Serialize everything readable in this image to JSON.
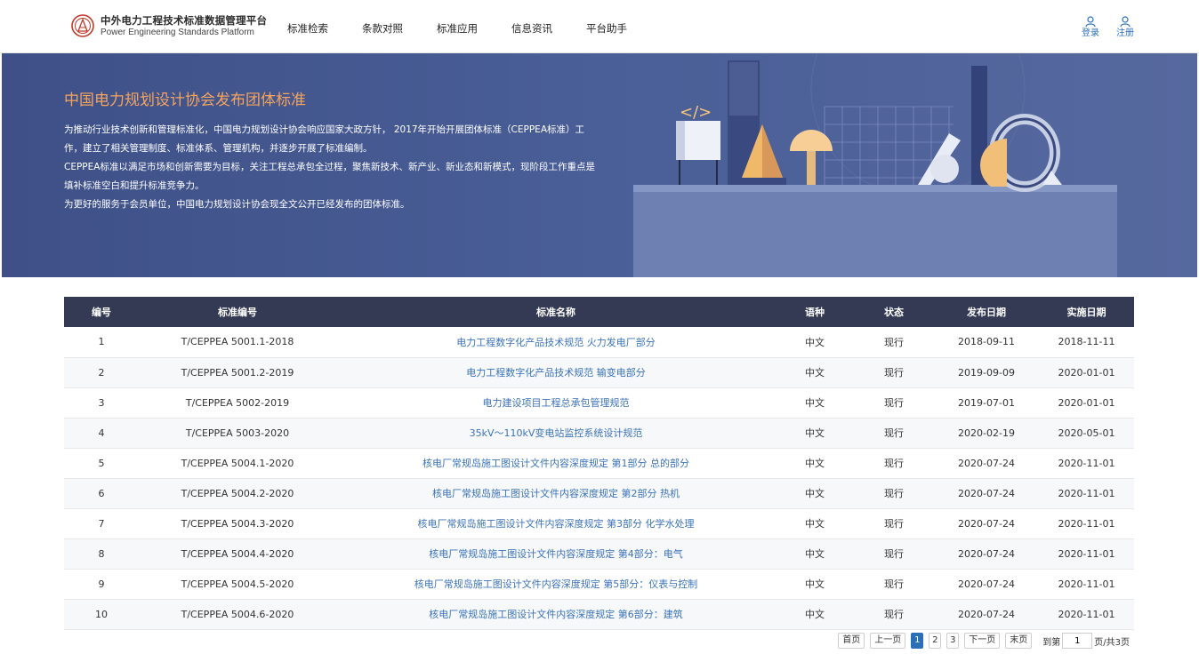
{
  "header": {
    "brand_cn": "中外电力工程技术标准数据管理平台",
    "brand_en": "Power Engineering Standards Platform",
    "nav": [
      "标准检索",
      "条款对照",
      "标准应用",
      "信息资讯",
      "平台助手"
    ],
    "login_label": "登录",
    "register_label": "注册"
  },
  "banner": {
    "title": "中国电力规划设计协会发布团体标准",
    "paragraphs": [
      "为推动行业技术创新和管理标准化，中国电力规划设计协会响应国家大政方针， 2017年开始开展团体标准（CEPPEA标准）工作，建立了相关管理制度、标准体系、管理机构，并逐步开展了标准编制。",
      "CEPPEA标准以满足市场和创新需要为目标，关注工程总承包全过程，聚焦新技术、新产业、新业态和新模式，现阶段工作重点是填补标准空白和提升标准竞争力。",
      "为更好的服务于会员单位，中国电力规划设计协会现全文公开已经发布的团体标准。"
    ]
  },
  "table": {
    "headers": [
      "编号",
      "标准编号",
      "标准名称",
      "语种",
      "状态",
      "发布日期",
      "实施日期"
    ],
    "rows": [
      [
        "1",
        "T/CEPPEA 5001.1-2018",
        "电力工程数字化产品技术规范 火力发电厂部分",
        "中文",
        "现行",
        "2018-09-11",
        "2018-11-11"
      ],
      [
        "2",
        "T/CEPPEA 5001.2-2019",
        "电力工程数字化产品技术规范 输变电部分",
        "中文",
        "现行",
        "2019-09-09",
        "2020-01-01"
      ],
      [
        "3",
        "T/CEPPEA 5002-2019",
        "电力建设项目工程总承包管理规范",
        "中文",
        "现行",
        "2019-07-01",
        "2020-01-01"
      ],
      [
        "4",
        "T/CEPPEA 5003-2020",
        "35kV～110kV变电站监控系统设计规范",
        "中文",
        "现行",
        "2020-02-19",
        "2020-05-01"
      ],
      [
        "5",
        "T/CEPPEA 5004.1-2020",
        "核电厂常规岛施工图设计文件内容深度规定 第1部分 总的部分",
        "中文",
        "现行",
        "2020-07-24",
        "2020-11-01"
      ],
      [
        "6",
        "T/CEPPEA 5004.2-2020",
        "核电厂常规岛施工图设计文件内容深度规定 第2部分 热机",
        "中文",
        "现行",
        "2020-07-24",
        "2020-11-01"
      ],
      [
        "7",
        "T/CEPPEA 5004.3-2020",
        "核电厂常规岛施工图设计文件内容深度规定 第3部分 化学水处理",
        "中文",
        "现行",
        "2020-07-24",
        "2020-11-01"
      ],
      [
        "8",
        "T/CEPPEA 5004.4-2020",
        "核电厂常规岛施工图设计文件内容深度规定 第4部分：电气",
        "中文",
        "现行",
        "2020-07-24",
        "2020-11-01"
      ],
      [
        "9",
        "T/CEPPEA 5004.5-2020",
        "核电厂常规岛施工图设计文件内容深度规定 第5部分：仪表与控制",
        "中文",
        "现行",
        "2020-07-24",
        "2020-11-01"
      ],
      [
        "10",
        "T/CEPPEA 5004.6-2020",
        "核电厂常规岛施工图设计文件内容深度规定 第6部分：建筑",
        "中文",
        "现行",
        "2020-07-24",
        "2020-11-01"
      ]
    ]
  },
  "pager": {
    "first": "首页",
    "prev": "上一页",
    "pages": [
      "1",
      "2",
      "3"
    ],
    "current": "1",
    "next": "下一页",
    "last": "末页",
    "goto_label": "到第",
    "goto_value": "1",
    "total_label": "页/共3页"
  },
  "colors": {
    "banner_bg": "#4a5e97",
    "banner_title": "#f5a45f",
    "table_header_bg": "#343a53",
    "link": "#3b73b9",
    "accent": "#2d6fb6"
  }
}
